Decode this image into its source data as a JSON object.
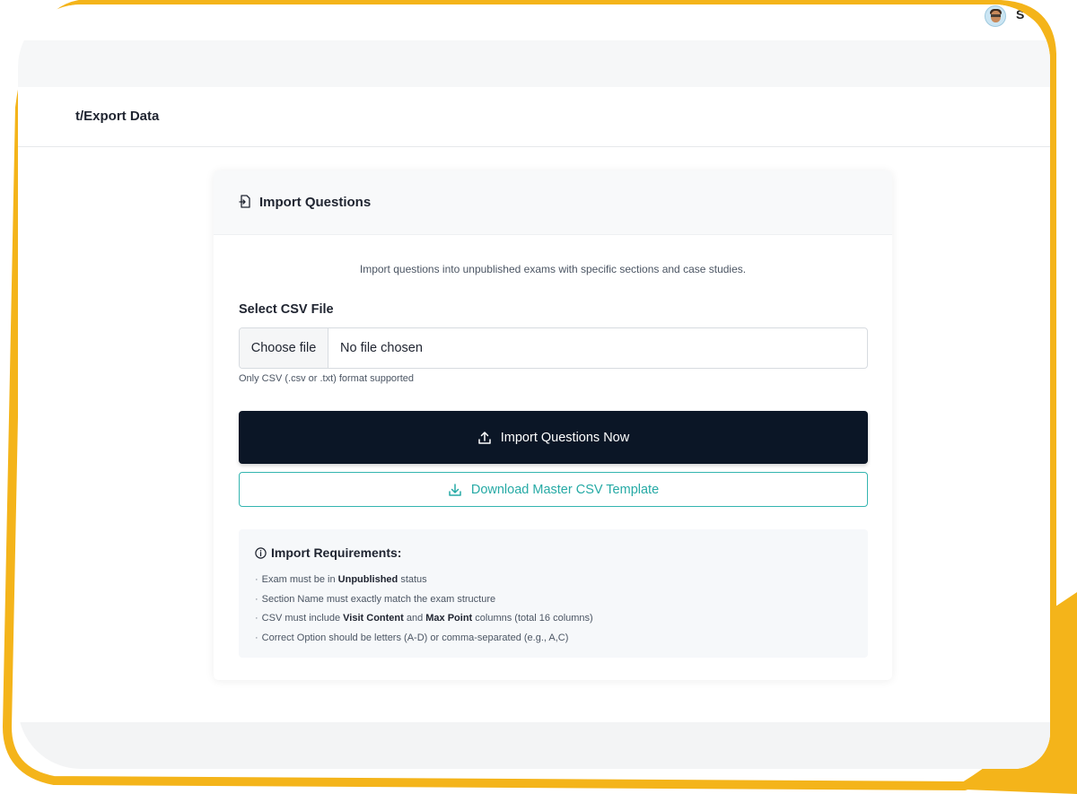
{
  "user": {
    "avatar_icon": "user-avatar",
    "initial": "S"
  },
  "header": {
    "title": "t/Export Data"
  },
  "card": {
    "icon": "file-import-icon",
    "title": "Import Questions",
    "description": "Import questions into unpublished exams with specific sections and case studies.",
    "file_field": {
      "label": "Select CSV File",
      "button_label": "Choose file",
      "status": "No file chosen",
      "hint": "Only CSV (.csv or .txt) format supported"
    },
    "primary_button": {
      "label": "Import Questions Now",
      "icon": "upload-icon"
    },
    "secondary_button": {
      "label": "Download Master CSV Template",
      "icon": "download-icon"
    },
    "requirements": {
      "icon": "info-icon",
      "title": "Import Requirements:",
      "items": [
        {
          "before": "Exam must be in ",
          "b1": "Unpublished",
          "mid": " status",
          "b2": "",
          "after": ""
        },
        {
          "before": "Section Name must exactly match the exam structure",
          "b1": "",
          "mid": "",
          "b2": "",
          "after": ""
        },
        {
          "before": "CSV must include ",
          "b1": "Visit Content",
          "mid": " and ",
          "b2": "Max Point",
          "after": " columns (total 16 columns)"
        },
        {
          "before": "Correct Option should be letters (A-D) or comma-separated (e.g., A,C)",
          "b1": "",
          "mid": "",
          "b2": "",
          "after": ""
        }
      ]
    }
  },
  "colors": {
    "frame": "#f4b41a",
    "primary_button": "#0b1626",
    "accent": "#34b5b0"
  }
}
